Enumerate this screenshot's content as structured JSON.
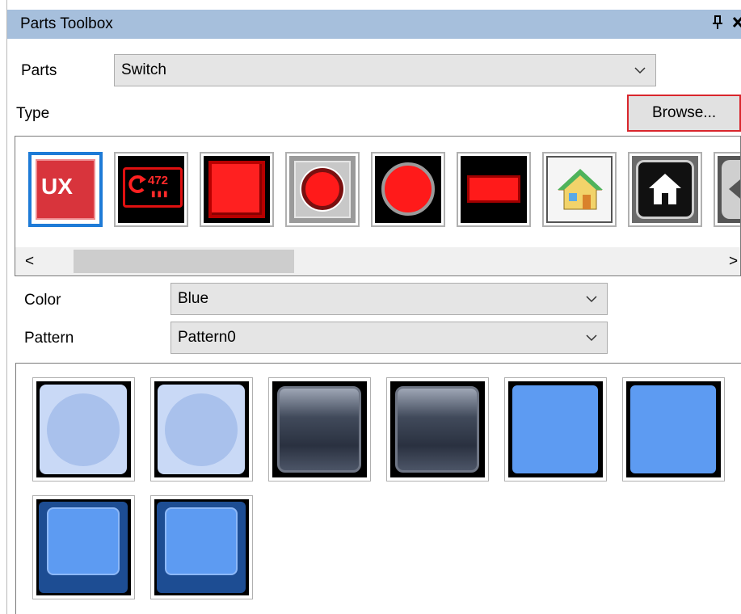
{
  "panel": {
    "title": "Parts Toolbox",
    "pin_glyph": "↕",
    "close_glyph": "✕"
  },
  "parts": {
    "label": "Parts",
    "value": "Switch"
  },
  "type": {
    "label": "Type",
    "browse_label": "Browse...",
    "items": [
      {
        "name": "ux-switch",
        "text": "UX",
        "selected": true
      },
      {
        "name": "counter-switch",
        "text": "472"
      },
      {
        "name": "red-square-switch"
      },
      {
        "name": "red-round-button-switch"
      },
      {
        "name": "red-circle-switch"
      },
      {
        "name": "red-rectangle-switch"
      },
      {
        "name": "house-icon-switch"
      },
      {
        "name": "dark-house-switch"
      },
      {
        "name": "arrow-switch"
      }
    ],
    "scroll_left": "<",
    "scroll_right": ">"
  },
  "color": {
    "label": "Color",
    "value": "Blue"
  },
  "pattern": {
    "label": "Pattern",
    "value": "Pattern0"
  },
  "patterns": [
    {
      "name": "light-circle-off"
    },
    {
      "name": "light-circle-on"
    },
    {
      "name": "glass-square-off"
    },
    {
      "name": "glass-square-on"
    },
    {
      "name": "flat-blue-square-off"
    },
    {
      "name": "flat-blue-square-on"
    },
    {
      "name": "beveled-blue-key-off"
    },
    {
      "name": "beveled-blue-key-on"
    }
  ],
  "colors": {
    "titlebar": "#a6bfdc",
    "selection": "#1e7bd7",
    "highlight_border": "#d9262c",
    "switch_blue": "#5d9bf2"
  }
}
